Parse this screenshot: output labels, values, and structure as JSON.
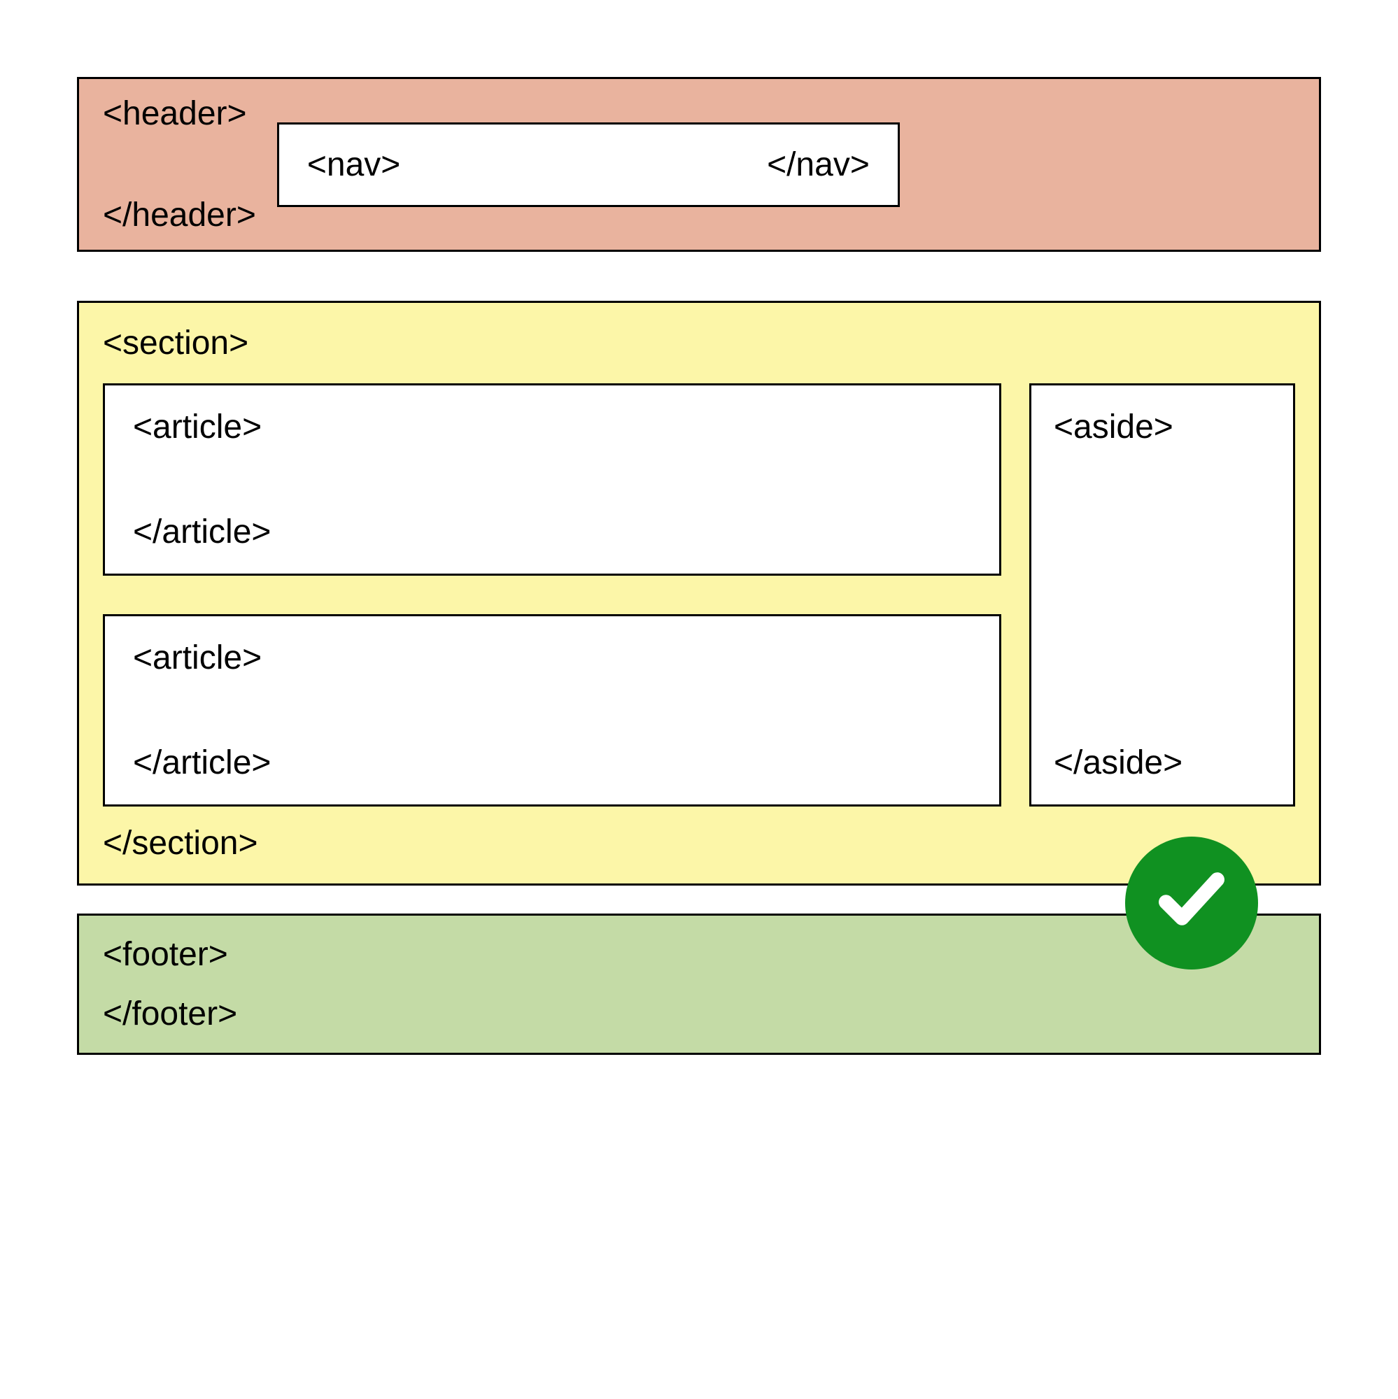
{
  "header": {
    "open": "<header>",
    "close": "</header>",
    "nav": {
      "open": "<nav>",
      "close": "</nav>"
    }
  },
  "section": {
    "open": "<section>",
    "close": "</section>",
    "articles": [
      {
        "open": "<article>",
        "close": "</article>"
      },
      {
        "open": "<article>",
        "close": "</article>"
      }
    ],
    "aside": {
      "open": "<aside>",
      "close": "</aside>"
    }
  },
  "footer": {
    "open": "<footer>",
    "close": "</footer>"
  },
  "badge": {
    "icon": "checkmark"
  },
  "colors": {
    "header_bg": "#e9b39e",
    "section_bg": "#fcf6a8",
    "footer_bg": "#c4dba6",
    "inner_bg": "#ffffff",
    "badge_bg": "#109121"
  }
}
